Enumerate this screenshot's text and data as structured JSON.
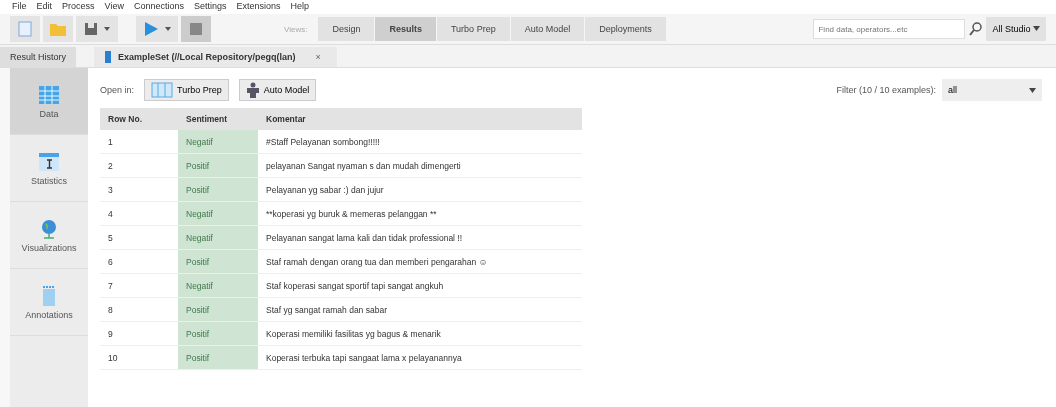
{
  "menu": [
    "File",
    "Edit",
    "Process",
    "View",
    "Connections",
    "Settings",
    "Extensions",
    "Help"
  ],
  "views": {
    "label": "Views:",
    "items": [
      {
        "label": "Design",
        "selected": false
      },
      {
        "label": "Results",
        "selected": true
      },
      {
        "label": "Turbo Prep",
        "selected": false
      },
      {
        "label": "Auto Model",
        "selected": false
      },
      {
        "label": "Deployments",
        "selected": false
      }
    ]
  },
  "search": {
    "placeholder": "Find data, operators...etc",
    "scope": "All Studio"
  },
  "panel_tabs": [
    {
      "label": "Result History",
      "selected": false
    },
    {
      "label": "ExampleSet (//Local Repository/pegq(lan)",
      "selected": true,
      "close": "×"
    }
  ],
  "sidebar": [
    {
      "label": "Data",
      "kind": "data",
      "selected": true
    },
    {
      "label": "Statistics",
      "kind": "statistics",
      "selected": false
    },
    {
      "label": "Visualizations",
      "kind": "visualizations",
      "selected": false
    },
    {
      "label": "Annotations",
      "kind": "annotations",
      "selected": false
    }
  ],
  "open_in": {
    "label": "Open in:",
    "buttons": [
      {
        "label": "Turbo Prep",
        "kind": "turbo"
      },
      {
        "label": "Auto Model",
        "kind": "auto"
      }
    ]
  },
  "filter": {
    "label": "Filter (10 / 10 examples):",
    "value": "all"
  },
  "table": {
    "columns": [
      "Row No.",
      "Sentiment",
      "Komentar"
    ],
    "rows": [
      [
        "1",
        "Negatif",
        "#Staff Pelayanan sombong!!!!!"
      ],
      [
        "2",
        "Positif",
        "pelayanan Sangat nyaman s dan mudah dimengerti"
      ],
      [
        "3",
        "Positif",
        "Pelayanan yg sabar :) dan jujur"
      ],
      [
        "4",
        "Negatif",
        "**koperasi yg buruk & memeras pelanggan **"
      ],
      [
        "5",
        "Negatif",
        "Pelayanan sangat lama kali dan tidak professional !!"
      ],
      [
        "6",
        "Positif",
        "Staf ramah dengan orang tua dan memberi pengarahan ☺"
      ],
      [
        "7",
        "Negatif",
        "Staf koperasi sangat sportif tapi sangat angkuh"
      ],
      [
        "8",
        "Positif",
        "Staf yg sangat ramah dan sabar"
      ],
      [
        "9",
        "Positif",
        "Koperasi memiliki fasilitas yg bagus & menarik"
      ],
      [
        "10",
        "Positif",
        "Koperasi terbuka tapi sangaat lama x pelayanannya"
      ]
    ]
  }
}
